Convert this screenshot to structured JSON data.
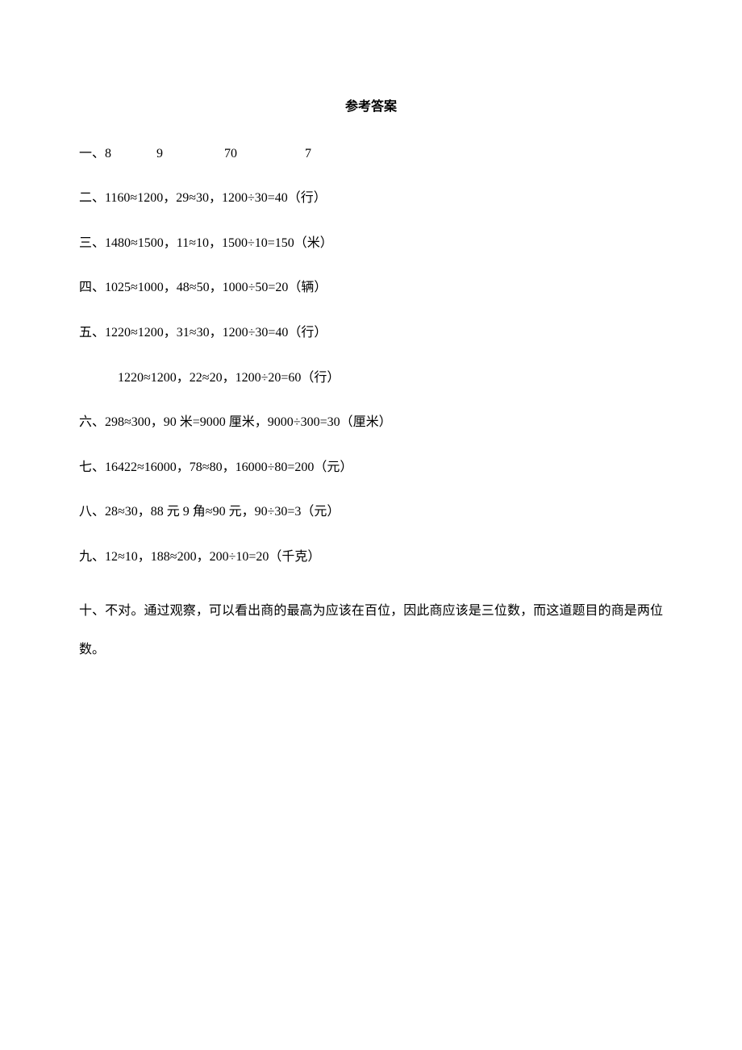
{
  "title": "参考答案",
  "answers": {
    "line1": "一、8              9                   70                     7",
    "line2": "二、1160≈1200，29≈30，1200÷30=40（行）",
    "line3": "三、1480≈1500，11≈10，1500÷10=150（米）",
    "line4": "四、1025≈1000，48≈50，1000÷50=20（辆）",
    "line5": "五、1220≈1200，31≈30，1200÷30=40（行）",
    "line5b": "1220≈1200，22≈20，1200÷20=60（行）",
    "line6": "六、298≈300，90 米=9000 厘米，9000÷300=30（厘米）",
    "line7": "七、16422≈16000，78≈80，16000÷80=200（元）",
    "line8": "八、28≈30，88 元 9 角≈90 元，90÷30=3（元）",
    "line9": "九、12≈10，188≈200，200÷10=20（千克）",
    "line10": "十、不对。通过观察，可以看出商的最高为应该在百位，因此商应该是三位数，而这道题目的商是两位数。"
  }
}
